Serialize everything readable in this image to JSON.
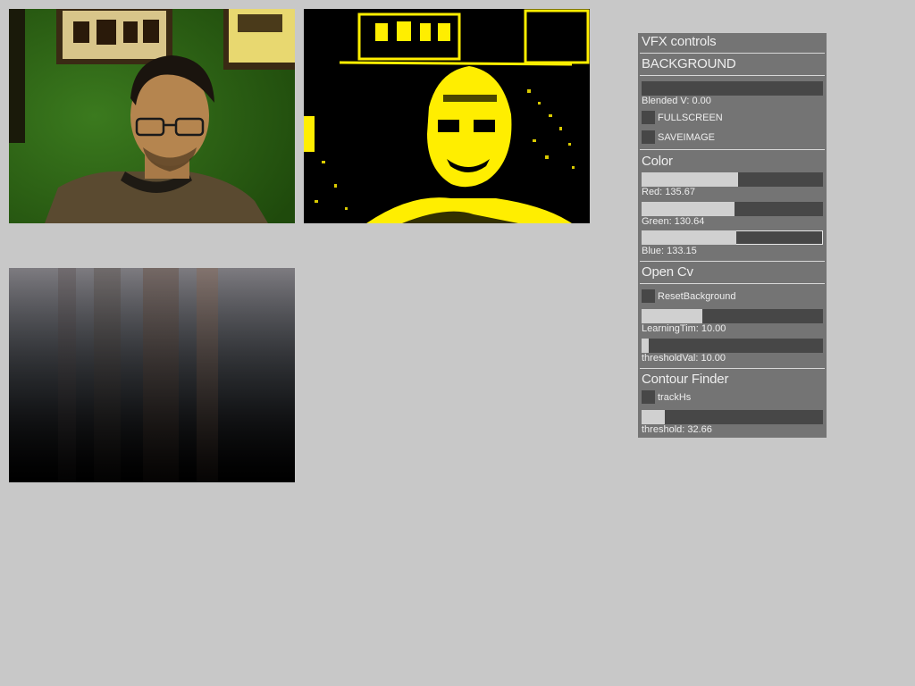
{
  "panel": {
    "title": "VFX controls",
    "sections": {
      "background": {
        "title": "BACKGROUND",
        "blended": {
          "label": "Blended V: 0.00",
          "value_fraction": 0.0
        },
        "fullscreen_label": "FULLSCREEN",
        "saveimage_label": "SAVEIMAGE"
      },
      "color": {
        "title": "Color",
        "red": {
          "label": "Red: 135.67",
          "value_fraction": 0.532
        },
        "green": {
          "label": "Green: 130.64",
          "value_fraction": 0.512
        },
        "blue": {
          "label": "Blue: 133.15",
          "value_fraction": 0.522
        }
      },
      "opencv": {
        "title": "Open Cv",
        "reset_label": "ResetBackground",
        "learning": {
          "label": "LearningTim: 10.00",
          "value_fraction": 0.335
        },
        "threshold": {
          "label": "thresholdVal: 10.00",
          "value_fraction": 0.04
        }
      },
      "contour": {
        "title": "Contour Finder",
        "track_label": "trackHs",
        "threshold": {
          "label": "threshold: 32.66",
          "value_fraction": 0.128
        }
      }
    }
  },
  "colors": {
    "app_background": "#c8c8c8",
    "panel_background": "#747474",
    "slider_track": "#474747",
    "slider_fill": "#d0d0d0",
    "threshold_highlight": "#ffee00"
  }
}
